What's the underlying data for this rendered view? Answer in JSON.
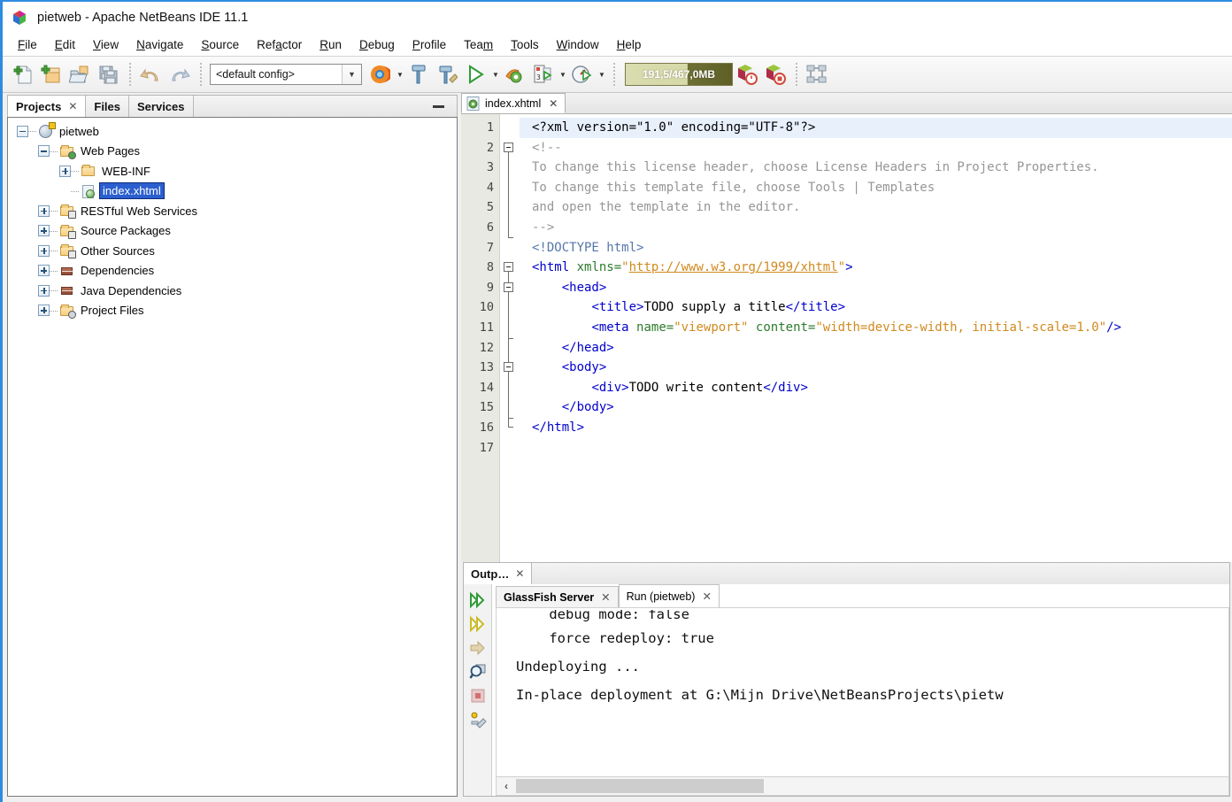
{
  "window": {
    "title": "pietweb - Apache NetBeans IDE 11.1",
    "app_icon": "netbeans-logo-icon"
  },
  "menubar": {
    "items": [
      {
        "label": "File",
        "mnemonic_index": 0
      },
      {
        "label": "Edit",
        "mnemonic_index": 0
      },
      {
        "label": "View",
        "mnemonic_index": 0
      },
      {
        "label": "Navigate",
        "mnemonic_index": 0
      },
      {
        "label": "Source",
        "mnemonic_index": 0
      },
      {
        "label": "Refactor",
        "mnemonic_index": 3
      },
      {
        "label": "Run",
        "mnemonic_index": 0
      },
      {
        "label": "Debug",
        "mnemonic_index": 0
      },
      {
        "label": "Profile",
        "mnemonic_index": 0
      },
      {
        "label": "Team",
        "mnemonic_index": 3
      },
      {
        "label": "Tools",
        "mnemonic_index": 0
      },
      {
        "label": "Window",
        "mnemonic_index": 0
      },
      {
        "label": "Help",
        "mnemonic_index": 0
      }
    ]
  },
  "toolbar": {
    "buttons": [
      {
        "name": "new-file-icon"
      },
      {
        "name": "new-project-icon"
      },
      {
        "name": "open-project-icon"
      },
      {
        "name": "save-all-icon"
      },
      {
        "name": "undo-icon"
      },
      {
        "name": "redo-icon"
      }
    ],
    "config_combo": {
      "value": "<default config>"
    },
    "run_buttons": [
      {
        "name": "browser-firefox-icon"
      },
      {
        "name": "build-project-hammer-icon"
      },
      {
        "name": "clean-and-build-icon"
      },
      {
        "name": "run-project-icon"
      },
      {
        "name": "debug-project-icon"
      },
      {
        "name": "profile-project-icon"
      },
      {
        "name": "test-project-icon"
      }
    ],
    "memory_gauge": {
      "label": "191,5/467,0MB",
      "used_mb": 191.5,
      "total_mb": 467.0
    },
    "right_buttons": [
      {
        "name": "local-history-icon"
      },
      {
        "name": "stop-build-icon"
      },
      {
        "name": "uml-diagram-icon"
      }
    ]
  },
  "explorer": {
    "tabs": [
      {
        "label": "Projects",
        "active": true,
        "closable": true
      },
      {
        "label": "Files",
        "active": false,
        "closable": false
      },
      {
        "label": "Services",
        "active": false,
        "closable": false
      }
    ],
    "minimize_label": "minimize-window",
    "tree": [
      {
        "label": "pietweb",
        "depth": 0,
        "state": "expanded",
        "icon": "project-webapp-icon",
        "selected": false
      },
      {
        "label": "Web Pages",
        "depth": 1,
        "state": "expanded",
        "icon": "folder-webpages-icon",
        "selected": false
      },
      {
        "label": "WEB-INF",
        "depth": 2,
        "state": "collapsed",
        "icon": "folder-icon",
        "selected": false
      },
      {
        "label": "index.xhtml",
        "depth": 2,
        "state": "leaf",
        "icon": "xhtml-file-icon",
        "selected": true
      },
      {
        "label": "RESTful Web Services",
        "depth": 1,
        "state": "collapsed",
        "icon": "folder-rest-icon",
        "selected": false
      },
      {
        "label": "Source Packages",
        "depth": 1,
        "state": "collapsed",
        "icon": "folder-sources-icon",
        "selected": false
      },
      {
        "label": "Other Sources",
        "depth": 1,
        "state": "collapsed",
        "icon": "folder-other-icon",
        "selected": false
      },
      {
        "label": "Dependencies",
        "depth": 1,
        "state": "collapsed",
        "icon": "libraries-icon",
        "selected": false
      },
      {
        "label": "Java Dependencies",
        "depth": 1,
        "state": "collapsed",
        "icon": "libraries-icon",
        "selected": false
      },
      {
        "label": "Project Files",
        "depth": 1,
        "state": "collapsed",
        "icon": "folder-projectfiles-icon",
        "selected": false
      }
    ]
  },
  "editor": {
    "tab": {
      "label": "index.xhtml",
      "icon": "xhtml-file-icon",
      "closable": true
    },
    "current_line": 1,
    "total_lines_shown": 17,
    "line_numbers": [
      "1",
      "2",
      "3",
      "4",
      "5",
      "6",
      "7",
      "8",
      "9",
      "10",
      "11",
      "12",
      "13",
      "14",
      "15",
      "16",
      "17"
    ],
    "fold_lines": [
      2,
      8,
      9,
      13
    ],
    "lines": [
      "<?xml version=\"1.0\" encoding=\"UTF-8\"?>",
      "<!--",
      "To change this license header, choose License Headers in Project Properties.",
      "To change this template file, choose Tools | Templates",
      "and open the template in the editor.",
      "-->",
      "<!DOCTYPE html>",
      "<html xmlns=\"http://www.w3.org/1999/xhtml\">",
      "    <head>",
      "        <title>TODO supply a title</title>",
      "        <meta name=\"viewport\" content=\"width=device-width, initial-scale=1.0\"/>",
      "    </head>",
      "    <body>",
      "        <div>TODO write content</div>",
      "    </body>",
      "</html>",
      ""
    ]
  },
  "output": {
    "window_tab": {
      "label": "Outp…",
      "closable": true
    },
    "toolbar_icons": [
      {
        "name": "rerun-green-icon"
      },
      {
        "name": "rerun-yellow-icon"
      },
      {
        "name": "forward-arrow-icon"
      },
      {
        "name": "find-in-output-icon"
      },
      {
        "name": "stop-process-icon"
      },
      {
        "name": "output-settings-icon"
      }
    ],
    "tabs": [
      {
        "label": "GlassFish Server",
        "active": false,
        "closable": true
      },
      {
        "label": "Run (pietweb)",
        "active": true,
        "closable": true
      }
    ],
    "lines": [
      "    debug mode: false",
      "    force redeploy: true",
      "Undeploying ...",
      "In-place deployment at G:\\Mijn Drive\\NetBeansProjects\\pietw"
    ],
    "scrollbar": {
      "left_arrow": "‹"
    }
  },
  "colors": {
    "accent_border": "#2d8ce0",
    "selection_blue": "#2b5fcf",
    "current_line": "#e8f0fc",
    "tag": "#0000cc",
    "attr": "#2c7a2c",
    "value": "#d08a1d",
    "comment": "#969696",
    "gauge": "#5d5f26"
  }
}
